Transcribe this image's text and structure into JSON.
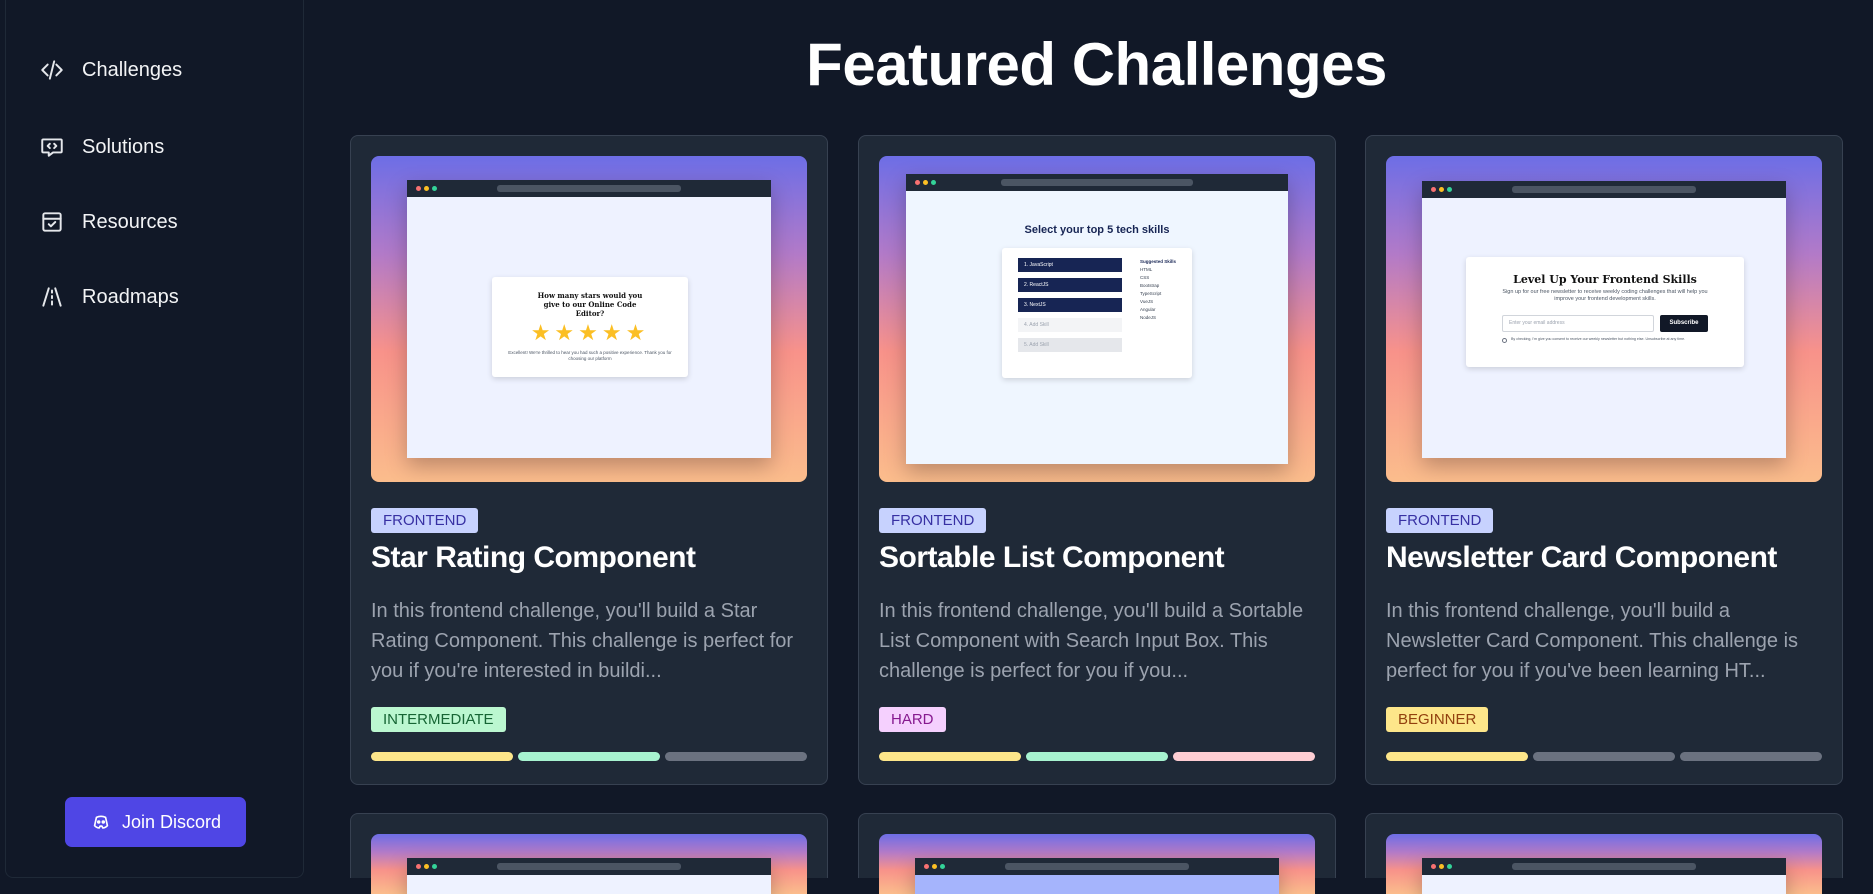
{
  "sidebar": {
    "items": [
      {
        "label": "Challenges",
        "icon": "code-icon"
      },
      {
        "label": "Solutions",
        "icon": "chat-code-icon"
      },
      {
        "label": "Resources",
        "icon": "calendar-check-icon"
      },
      {
        "label": "Roadmaps",
        "icon": "road-icon"
      }
    ],
    "discord_label": "Join Discord"
  },
  "main": {
    "title": "Featured Challenges",
    "cards": [
      {
        "category": "FRONTEND",
        "title": "Star Rating Component",
        "description": "In this frontend challenge, you'll build a Star Rating Component. This challenge is perfect for you if you're interested in buildi...",
        "level": "INTERMEDIATE",
        "level_bg": "#bbf7d0",
        "level_fg": "#166534",
        "difficulty_bars": [
          "#fde68a",
          "#a7f3d0",
          "#6b7280"
        ],
        "preview": {
          "question": "How many stars would you give to our Online Code Editor?",
          "note": "Excellent! We're thrilled to hear you had such a positive experience. Thank you for choosing our platform",
          "stars": 5
        }
      },
      {
        "category": "FRONTEND",
        "title": "Sortable List Component",
        "description": "In this frontend challenge, you'll build a Sortable List Component with Search Input Box. This challenge is perfect for you if you...",
        "level": "HARD",
        "level_bg": "#f5d0fe",
        "level_fg": "#86198f",
        "difficulty_bars": [
          "#fde68a",
          "#a7f3d0",
          "#fecdd3"
        ],
        "preview": {
          "heading": "Select your top 5 tech skills",
          "list": [
            "1. JavaScript",
            "2. ReactJS",
            "3. NextJS",
            "4. Add Skill",
            "5. Add Skill"
          ],
          "suggested_title": "Suggested Skills",
          "suggested": [
            "HTML",
            "CSS",
            "Bootstrap",
            "TypeScript",
            "VueJS",
            "Angular",
            "NodeJS"
          ]
        }
      },
      {
        "category": "FRONTEND",
        "title": "Newsletter Card Component",
        "description": "In this frontend challenge, you'll build a Newsletter Card Component. This challenge is perfect for you if you've been learning HT...",
        "level": "BEGINNER",
        "level_bg": "#fde68a",
        "level_fg": "#92400e",
        "difficulty_bars": [
          "#fde68a",
          "#6b7280",
          "#6b7280"
        ],
        "preview": {
          "heading": "Level Up Your Frontend Skills",
          "sub": "Sign up for our free newsletter to receive weekly coding challenges that will help you improve your frontend development skills.",
          "placeholder": "Enter your email address",
          "button": "Subscribe",
          "consent": "By checking, I'm give you consent to receive our weekly newsletter but nothing else. Unsubscribe at any time."
        }
      }
    ]
  }
}
